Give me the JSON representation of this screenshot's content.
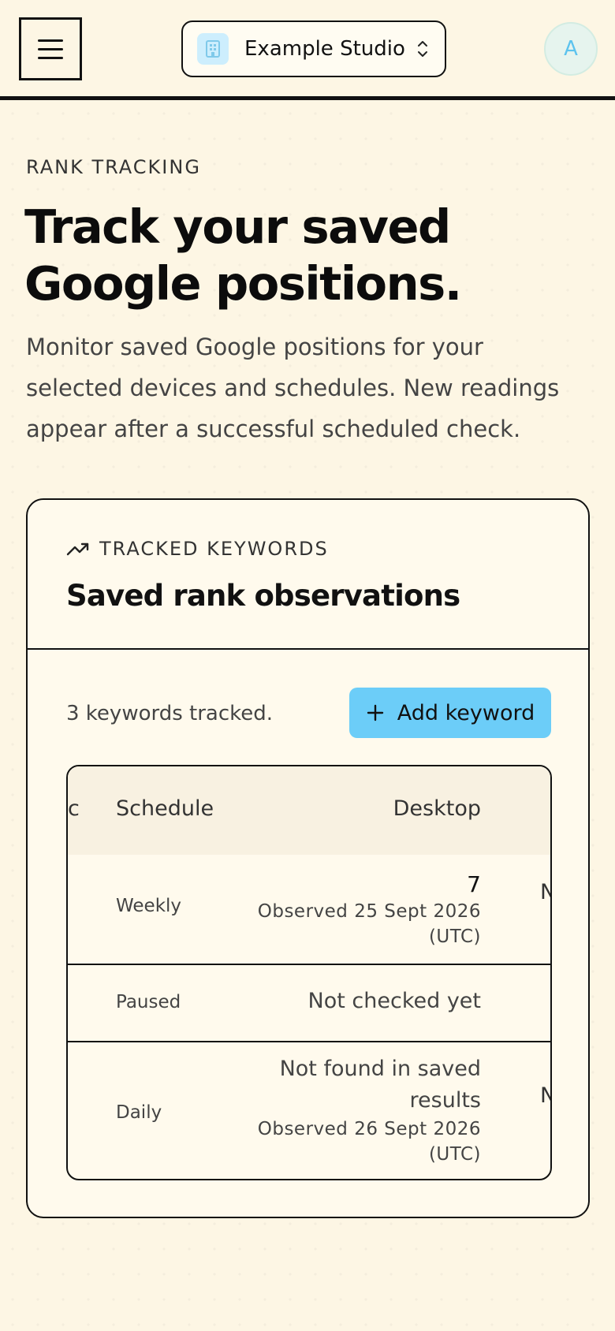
{
  "header": {
    "workspace_name": "Example Studio",
    "avatar_initial": "A"
  },
  "hero": {
    "eyebrow": "RANK TRACKING",
    "title_line1": "Track your saved",
    "title_line2": "Google positions.",
    "description": "Monitor saved Google positions for your selected devices and schedules. New readings appear after a successful scheduled check."
  },
  "card": {
    "eyebrow": "TRACKED KEYWORDS",
    "title": "Saved rank observations",
    "count_text": "3 keywords tracked.",
    "add_button_label": "Add keyword"
  },
  "table": {
    "columns": {
      "clipped": "c",
      "schedule": "Schedule",
      "desktop": "Desktop"
    },
    "rows": [
      {
        "schedule": "Weekly",
        "desktop_rank": "7",
        "desktop_observed": "Observed 25 Sept 2026",
        "desktop_tz": "(UTC)",
        "next_clipped": "N"
      },
      {
        "schedule": "Paused",
        "desktop_status": "Not checked yet"
      },
      {
        "schedule": "Daily",
        "desktop_status_line1": "Not found in saved",
        "desktop_status_line2": "results",
        "desktop_observed": "Observed 26 Sept 2026",
        "desktop_tz": "(UTC)",
        "next_clipped": "N"
      }
    ]
  },
  "colors": {
    "background": "#fdf6e4",
    "accent": "#6ccdf8",
    "border": "#111111"
  }
}
